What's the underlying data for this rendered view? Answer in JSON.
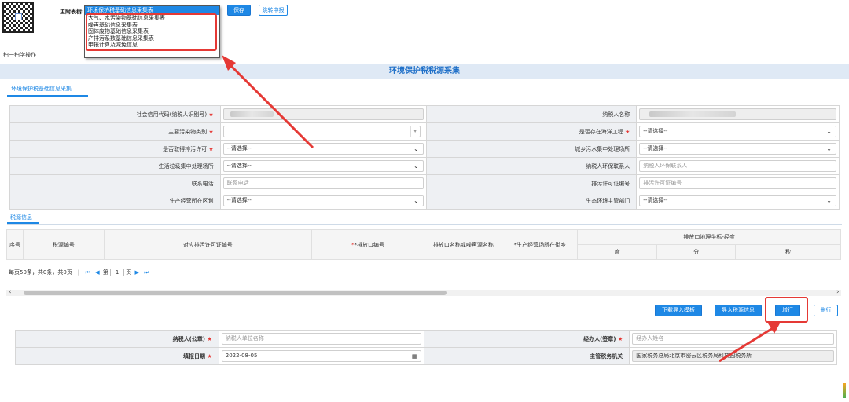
{
  "top": {
    "scan_label": "扫一扫学操作",
    "table_label": "主附表树:",
    "save_label": "保存",
    "transfer_label": "跳转申报",
    "dropdown": {
      "selected": "环境保护税基础信息采集表",
      "items": [
        "大气、水污染物基础信息采集表",
        "噪声基础信息采集表",
        "固体废物基础信息采集表",
        "产排污系数基础信息采集表",
        "申报计算及减免信息"
      ]
    }
  },
  "banner_title": "环境保护税税源采集",
  "section_tab": "环境保护税基础信息采集",
  "form": {
    "credit_code_label": "社会信用代码(纳税人识别号)",
    "taxpayer_name_label": "纳税人名称",
    "pollutant_label": "主要污染物类别",
    "ocean_label": "是否存在海洋工程",
    "ocean_value": "--请选择--",
    "permit_label": "是否取得排污许可",
    "permit_value": "--请选择--",
    "sewage_label": "城乡污水集中处理场所",
    "sewage_value": "--请选择--",
    "garbage_label": "生活垃圾集中处理场所",
    "garbage_value": "--请选择--",
    "contact_label": "纳税人环保联系人",
    "contact_placeholder": "纳税人环保联系人",
    "phone_label": "联系电话",
    "phone_placeholder": "联系电话",
    "permit_no_label": "排污许可证编号",
    "permit_no_placeholder": "排污许可证编号",
    "district_label": "生产经营所在区划",
    "district_value": "--请选择--",
    "eco_label": "生态环境主管部门",
    "eco_value": "--请选择--"
  },
  "tax_source_tab": "税源信息",
  "grid": {
    "headers": [
      "序号",
      "税源编号",
      "对应排污许可证编号",
      "*排放口编号",
      "排放口名称或噪声源名称",
      "*生产经营场所在街乡",
      "排放口地理坐标-经度"
    ],
    "sub_headers": [
      "度",
      "分",
      "秒"
    ]
  },
  "pager": {
    "info": "每页50条，共0条，共0页",
    "page_prefix": "第",
    "page_value": "1",
    "page_suffix": "页"
  },
  "actions": {
    "download_template": "下载导入模板",
    "import_source": "导入税源信息",
    "add_row": "增行",
    "delete_row": "删行"
  },
  "bottom": {
    "taxpayer_seal_label": "纳税人(公章)",
    "taxpayer_seal_placeholder": "纳税人单位名称",
    "agent_label": "经办人(签章)",
    "agent_placeholder": "经办人姓名",
    "fill_date_label": "填报日期",
    "fill_date_value": "2022-08-05",
    "tax_office_label": "主管税务机关",
    "tax_office_value": "国家税务总局北京市密云区税务局科技园税务所"
  },
  "colors": {
    "accent": "#1e88e5",
    "annotation": "#e53935",
    "banner": "#dfe9f5"
  }
}
